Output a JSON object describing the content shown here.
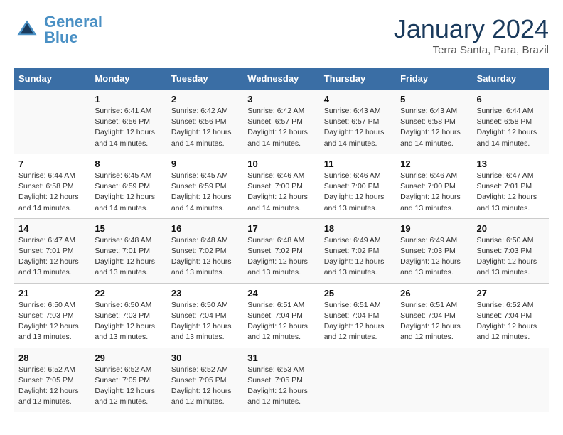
{
  "header": {
    "logo_general": "General",
    "logo_blue": "Blue",
    "month_title": "January 2024",
    "location": "Terra Santa, Para, Brazil"
  },
  "days_of_week": [
    "Sunday",
    "Monday",
    "Tuesday",
    "Wednesday",
    "Thursday",
    "Friday",
    "Saturday"
  ],
  "weeks": [
    [
      {
        "num": "",
        "sunrise": "",
        "sunset": "",
        "daylight": ""
      },
      {
        "num": "1",
        "sunrise": "Sunrise: 6:41 AM",
        "sunset": "Sunset: 6:56 PM",
        "daylight": "Daylight: 12 hours and 14 minutes."
      },
      {
        "num": "2",
        "sunrise": "Sunrise: 6:42 AM",
        "sunset": "Sunset: 6:56 PM",
        "daylight": "Daylight: 12 hours and 14 minutes."
      },
      {
        "num": "3",
        "sunrise": "Sunrise: 6:42 AM",
        "sunset": "Sunset: 6:57 PM",
        "daylight": "Daylight: 12 hours and 14 minutes."
      },
      {
        "num": "4",
        "sunrise": "Sunrise: 6:43 AM",
        "sunset": "Sunset: 6:57 PM",
        "daylight": "Daylight: 12 hours and 14 minutes."
      },
      {
        "num": "5",
        "sunrise": "Sunrise: 6:43 AM",
        "sunset": "Sunset: 6:58 PM",
        "daylight": "Daylight: 12 hours and 14 minutes."
      },
      {
        "num": "6",
        "sunrise": "Sunrise: 6:44 AM",
        "sunset": "Sunset: 6:58 PM",
        "daylight": "Daylight: 12 hours and 14 minutes."
      }
    ],
    [
      {
        "num": "7",
        "sunrise": "Sunrise: 6:44 AM",
        "sunset": "Sunset: 6:58 PM",
        "daylight": "Daylight: 12 hours and 14 minutes."
      },
      {
        "num": "8",
        "sunrise": "Sunrise: 6:45 AM",
        "sunset": "Sunset: 6:59 PM",
        "daylight": "Daylight: 12 hours and 14 minutes."
      },
      {
        "num": "9",
        "sunrise": "Sunrise: 6:45 AM",
        "sunset": "Sunset: 6:59 PM",
        "daylight": "Daylight: 12 hours and 14 minutes."
      },
      {
        "num": "10",
        "sunrise": "Sunrise: 6:46 AM",
        "sunset": "Sunset: 7:00 PM",
        "daylight": "Daylight: 12 hours and 14 minutes."
      },
      {
        "num": "11",
        "sunrise": "Sunrise: 6:46 AM",
        "sunset": "Sunset: 7:00 PM",
        "daylight": "Daylight: 12 hours and 13 minutes."
      },
      {
        "num": "12",
        "sunrise": "Sunrise: 6:46 AM",
        "sunset": "Sunset: 7:00 PM",
        "daylight": "Daylight: 12 hours and 13 minutes."
      },
      {
        "num": "13",
        "sunrise": "Sunrise: 6:47 AM",
        "sunset": "Sunset: 7:01 PM",
        "daylight": "Daylight: 12 hours and 13 minutes."
      }
    ],
    [
      {
        "num": "14",
        "sunrise": "Sunrise: 6:47 AM",
        "sunset": "Sunset: 7:01 PM",
        "daylight": "Daylight: 12 hours and 13 minutes."
      },
      {
        "num": "15",
        "sunrise": "Sunrise: 6:48 AM",
        "sunset": "Sunset: 7:01 PM",
        "daylight": "Daylight: 12 hours and 13 minutes."
      },
      {
        "num": "16",
        "sunrise": "Sunrise: 6:48 AM",
        "sunset": "Sunset: 7:02 PM",
        "daylight": "Daylight: 12 hours and 13 minutes."
      },
      {
        "num": "17",
        "sunrise": "Sunrise: 6:48 AM",
        "sunset": "Sunset: 7:02 PM",
        "daylight": "Daylight: 12 hours and 13 minutes."
      },
      {
        "num": "18",
        "sunrise": "Sunrise: 6:49 AM",
        "sunset": "Sunset: 7:02 PM",
        "daylight": "Daylight: 12 hours and 13 minutes."
      },
      {
        "num": "19",
        "sunrise": "Sunrise: 6:49 AM",
        "sunset": "Sunset: 7:03 PM",
        "daylight": "Daylight: 12 hours and 13 minutes."
      },
      {
        "num": "20",
        "sunrise": "Sunrise: 6:50 AM",
        "sunset": "Sunset: 7:03 PM",
        "daylight": "Daylight: 12 hours and 13 minutes."
      }
    ],
    [
      {
        "num": "21",
        "sunrise": "Sunrise: 6:50 AM",
        "sunset": "Sunset: 7:03 PM",
        "daylight": "Daylight: 12 hours and 13 minutes."
      },
      {
        "num": "22",
        "sunrise": "Sunrise: 6:50 AM",
        "sunset": "Sunset: 7:03 PM",
        "daylight": "Daylight: 12 hours and 13 minutes."
      },
      {
        "num": "23",
        "sunrise": "Sunrise: 6:50 AM",
        "sunset": "Sunset: 7:04 PM",
        "daylight": "Daylight: 12 hours and 13 minutes."
      },
      {
        "num": "24",
        "sunrise": "Sunrise: 6:51 AM",
        "sunset": "Sunset: 7:04 PM",
        "daylight": "Daylight: 12 hours and 12 minutes."
      },
      {
        "num": "25",
        "sunrise": "Sunrise: 6:51 AM",
        "sunset": "Sunset: 7:04 PM",
        "daylight": "Daylight: 12 hours and 12 minutes."
      },
      {
        "num": "26",
        "sunrise": "Sunrise: 6:51 AM",
        "sunset": "Sunset: 7:04 PM",
        "daylight": "Daylight: 12 hours and 12 minutes."
      },
      {
        "num": "27",
        "sunrise": "Sunrise: 6:52 AM",
        "sunset": "Sunset: 7:04 PM",
        "daylight": "Daylight: 12 hours and 12 minutes."
      }
    ],
    [
      {
        "num": "28",
        "sunrise": "Sunrise: 6:52 AM",
        "sunset": "Sunset: 7:05 PM",
        "daylight": "Daylight: 12 hours and 12 minutes."
      },
      {
        "num": "29",
        "sunrise": "Sunrise: 6:52 AM",
        "sunset": "Sunset: 7:05 PM",
        "daylight": "Daylight: 12 hours and 12 minutes."
      },
      {
        "num": "30",
        "sunrise": "Sunrise: 6:52 AM",
        "sunset": "Sunset: 7:05 PM",
        "daylight": "Daylight: 12 hours and 12 minutes."
      },
      {
        "num": "31",
        "sunrise": "Sunrise: 6:53 AM",
        "sunset": "Sunset: 7:05 PM",
        "daylight": "Daylight: 12 hours and 12 minutes."
      },
      {
        "num": "",
        "sunrise": "",
        "sunset": "",
        "daylight": ""
      },
      {
        "num": "",
        "sunrise": "",
        "sunset": "",
        "daylight": ""
      },
      {
        "num": "",
        "sunrise": "",
        "sunset": "",
        "daylight": ""
      }
    ]
  ]
}
